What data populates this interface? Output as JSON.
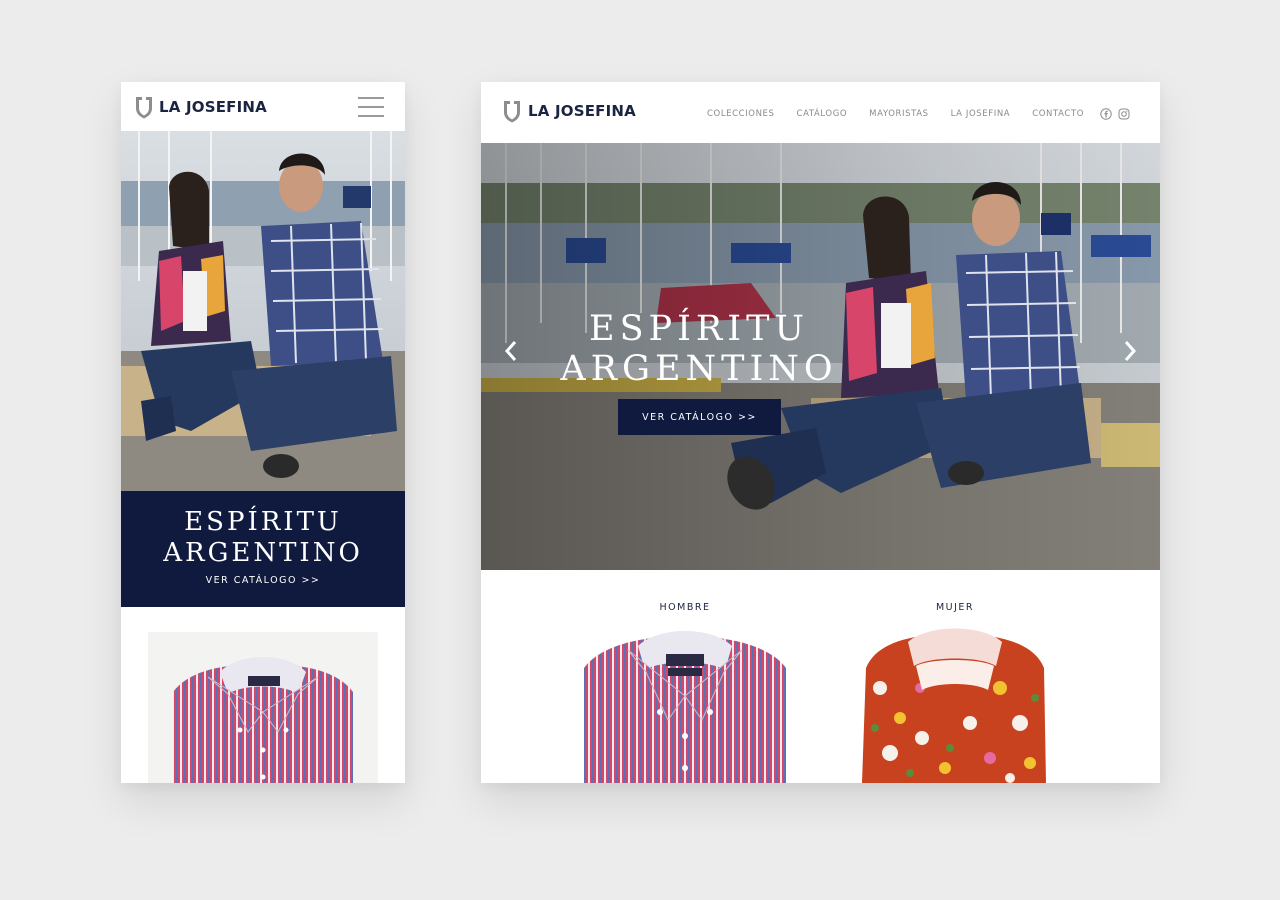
{
  "brand": {
    "name": "LA JOSEFINA",
    "navy": "#0f1a3e",
    "logo_gray": "#8d8d8d"
  },
  "mobile": {
    "menu_icon": "hamburger-icon",
    "hero": {
      "title_line1": "ESPÍRITU",
      "title_line2": "ARGENTINO",
      "cta": "VER CATÁLOGO >>"
    }
  },
  "desktop": {
    "nav": [
      "COLECCIONES",
      "CATÁLOGO",
      "MAYORISTAS",
      "LA JOSEFINA",
      "CONTACTO"
    ],
    "social_icons": [
      "facebook-icon",
      "instagram-icon"
    ],
    "hero": {
      "title_line1": "ESPÍRITU",
      "title_line2": "ARGENTINO",
      "cta": "VER CATÁLOGO >>",
      "prev_icon": "chevron-left-icon",
      "next_icon": "chevron-right-icon"
    },
    "categories": [
      {
        "label": "HOMBRE"
      },
      {
        "label": "MUJER"
      }
    ]
  }
}
